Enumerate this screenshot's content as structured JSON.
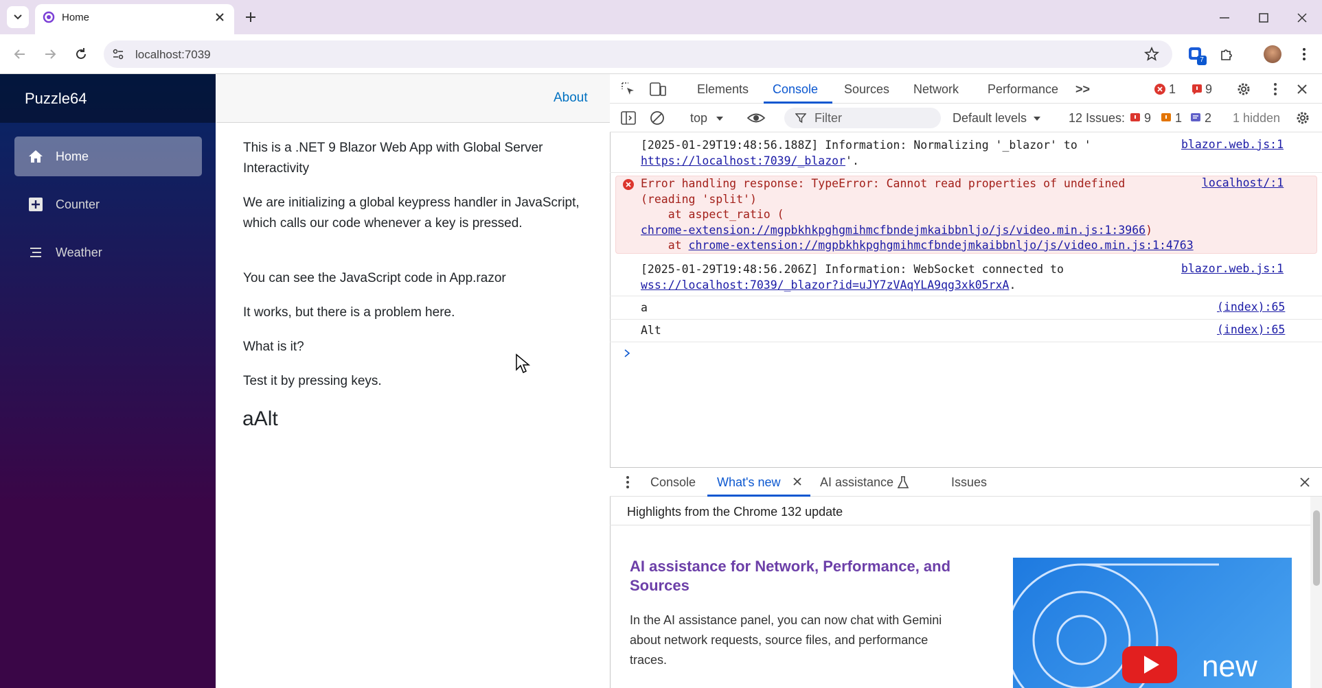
{
  "browser": {
    "tab_title": "Home",
    "url": "localhost:7039",
    "extension_badge": "7"
  },
  "app": {
    "brand": "Puzzle64",
    "nav": [
      {
        "label": "Home",
        "icon": "house-icon",
        "active": true
      },
      {
        "label": "Counter",
        "icon": "plus-square-icon",
        "active": false
      },
      {
        "label": "Weather",
        "icon": "list-icon",
        "active": false
      }
    ],
    "about_link": "About",
    "paragraphs": [
      "This is a .NET 9 Blazor Web App with Global Server Interactivity",
      "We are initializing a global keypress handler in JavaScript, which calls our code whenever a key is pressed.",
      "You can see the JavaScript code in App.razor",
      "It works, but there is a problem here.",
      "What is it?",
      "Test it by pressing keys."
    ],
    "key_output": "aAlt"
  },
  "devtools": {
    "tabs": [
      "Elements",
      "Console",
      "Sources",
      "Network",
      "Performance"
    ],
    "active_tab": "Console",
    "more_tabs": ">>",
    "error_count": "1",
    "issue_count": "9",
    "context": "top",
    "filter_placeholder": "Filter",
    "levels": "Default levels",
    "issues_label": "12 Issues:",
    "issues_errors": "9",
    "issues_warnings": "1",
    "issues_info": "2",
    "hidden_label": "1 hidden",
    "messages": {
      "m1_line1": "[2025-01-29T19:48:56.188Z] Information: Normalizing '_blazor' to '",
      "m1_link": "https://localhost:7039/_blazor",
      "m1_end": "'.",
      "m1_src": "blazor.web.js:1",
      "err_line1": "Error handling response: TypeError: Cannot read properties of undefined",
      "err_line2": "(reading 'split')",
      "err_line3": "    at aspect_ratio (",
      "err_link1": "chrome-extension://mgpbkhkpghgmihmcfbndejmkaibbnljo/js/video.min.js:1:3966",
      "err_link1_end": ")",
      "err_line5_prefix": "    at ",
      "err_link2": "chrome-extension://mgpbkhkpghgmihmcfbndejmkaibbnljo/js/video.min.js:1:4763",
      "err_src": "localhost/:1",
      "m2_line1": "[2025-01-29T19:48:56.206Z] Information: WebSocket connected to",
      "m2_link": "wss://localhost:7039/_blazor?id=uJY7zVAqYLA9qg3xk05rxA",
      "m2_end": ".",
      "m2_src": "blazor.web.js:1",
      "m3": "a",
      "m3_src": "(index):65",
      "m4": "Alt",
      "m4_src": "(index):65"
    },
    "drawer": {
      "tabs": [
        "Console",
        "What's new",
        "AI assistance",
        "Issues"
      ],
      "active_tab": "What's new",
      "highlights": "Highlights from the Chrome 132 update",
      "headline": "AI assistance for Network, Performance, and Sources",
      "body": "In the AI assistance panel, you can now chat with Gemini about network requests, source files, and performance traces.",
      "thumb_text": "new"
    }
  },
  "colors": {
    "sidebar_top": "#052767",
    "sidebar_bottom": "#3a0647",
    "link_blue": "#0071c1",
    "devtools_active": "#0b57d0",
    "error_red": "#dc362e"
  }
}
